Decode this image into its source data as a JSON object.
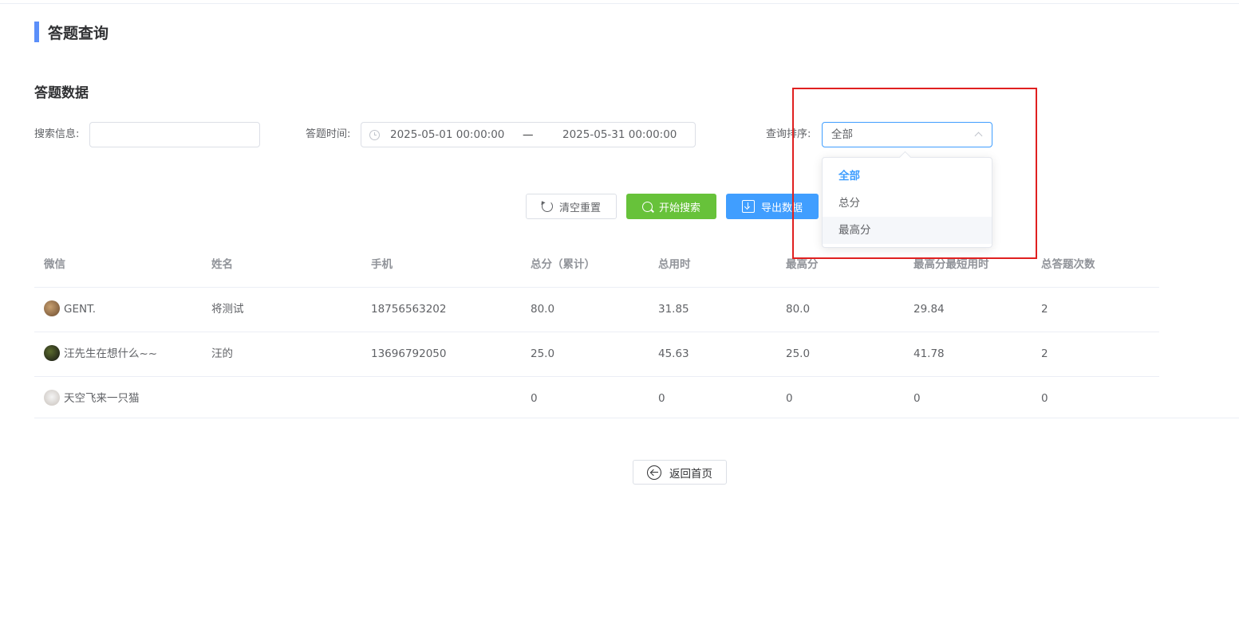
{
  "page": {
    "title": "答题查询",
    "accent": "#5b8ff9"
  },
  "section": {
    "title": "答题数据"
  },
  "filters": {
    "search_label": "搜索信息:",
    "search_value": "",
    "time_label": "答题时间:",
    "time_start": "2025-05-01 00:00:00",
    "time_separator": "—",
    "time_end": "2025-05-31 00:00:00",
    "sort_label": "查询排序:",
    "sort_value": "全部",
    "sort_options": [
      "全部",
      "总分",
      "最高分"
    ]
  },
  "buttons": {
    "reset": "清空重置",
    "search": "开始搜索",
    "export": "导出数据",
    "back": "返回首页"
  },
  "colors": {
    "primary": "#409eff",
    "success": "#67c23a",
    "highlight": "#e02020"
  },
  "table": {
    "headers": [
      "微信",
      "姓名",
      "手机",
      "总分（累计）",
      "总用时",
      "最高分",
      "最高分最短用时",
      "总答题次数"
    ],
    "rows": [
      [
        "GENT.",
        "将测试",
        "18756563202",
        "80.0",
        "31.85",
        "80.0",
        "29.84",
        "2"
      ],
      [
        "汪先生在想什么~~",
        "汪的",
        "13696792050",
        "25.0",
        "45.63",
        "25.0",
        "41.78",
        "2"
      ],
      [
        "天空飞来一只猫",
        "",
        "",
        "0",
        "0",
        "0",
        "0",
        "0"
      ]
    ]
  }
}
